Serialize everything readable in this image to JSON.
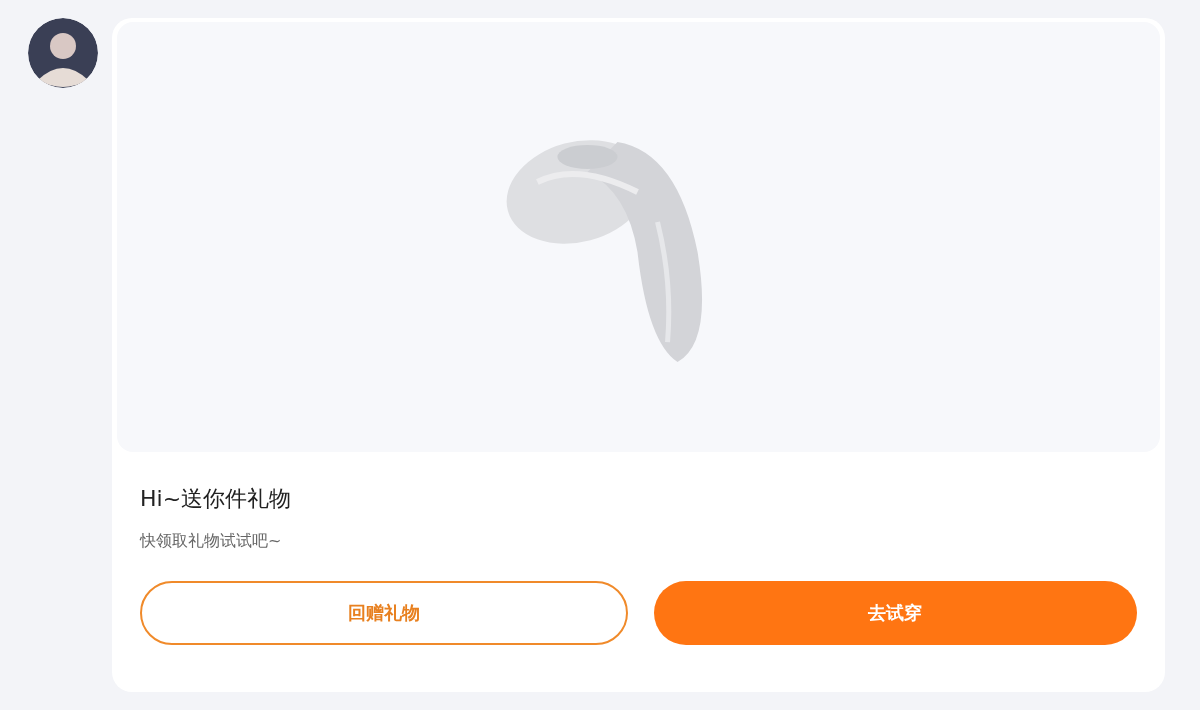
{
  "message": {
    "title": "Hi~送你件礼物",
    "subtitle": "快领取礼物试试吧~",
    "buttons": [
      {
        "label": "回赠礼物",
        "kind": "outline"
      },
      {
        "label": "去试穿",
        "kind": "primary"
      }
    ]
  }
}
